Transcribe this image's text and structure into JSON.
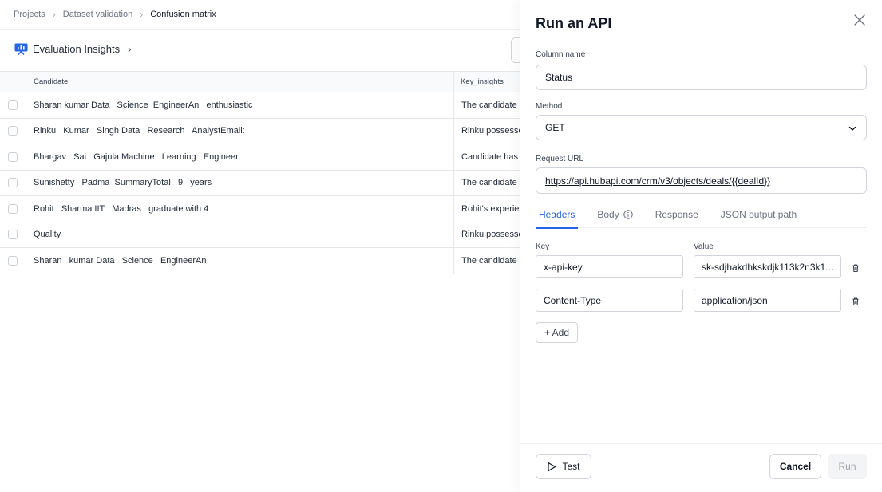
{
  "breadcrumb": [
    "Projects",
    "Dataset validation",
    "Confusion matrix"
  ],
  "section": {
    "title": "Evaluation Insights",
    "icon": "presentation-chart-icon"
  },
  "table": {
    "columns": [
      "Candidate",
      "Key_insights"
    ],
    "rows": [
      {
        "candidate": "Sharan kumar Data   Science  EngineerAn   enthusiastic",
        "insight": "The candidate"
      },
      {
        "candidate": "Rinku   Kumar   Singh Data   Research   AnalystEmail:",
        "insight": "Rinku possesse"
      },
      {
        "candidate": "Bhargav   Sai   Gajula Machine   Learning   Engineer",
        "insight": "Candidate has"
      },
      {
        "candidate": "Sunishetty   Padma  SummaryTotal   9   years",
        "insight": "The candidate"
      },
      {
        "candidate": "Rohit   Sharma IIT   Madras   graduate with 4",
        "insight": "Rohit's experie"
      },
      {
        "candidate": "Quality",
        "insight": "Rinku possesse"
      },
      {
        "candidate": "Sharan   kumar Data   Science   EngineerAn",
        "insight": "The candidate"
      }
    ]
  },
  "drawer": {
    "title": "Run an API",
    "column_name_label": "Column name",
    "column_name_value": "Status",
    "method_label": "Method",
    "method_value": "GET",
    "url_label": "Request URL",
    "url_value": "https://api.hubapi.com/crm/v3/objects/deals/{{dealId}}",
    "tabs": [
      "Headers",
      "Body",
      "Response",
      "JSON output path"
    ],
    "active_tab": "Headers",
    "key_label": "Key",
    "value_label": "Value",
    "headers": [
      {
        "key": "x-api-key",
        "value": "sk-sdjhakdhkskdjk113k2n3k1..."
      },
      {
        "key": "Content-Type",
        "value": "application/json"
      }
    ],
    "add_label": "+ Add",
    "test_label": "Test",
    "cancel_label": "Cancel",
    "run_label": "Run"
  },
  "colors": {
    "accent": "#2563eb",
    "border": "#d1d5db",
    "muted": "#6b7280"
  }
}
